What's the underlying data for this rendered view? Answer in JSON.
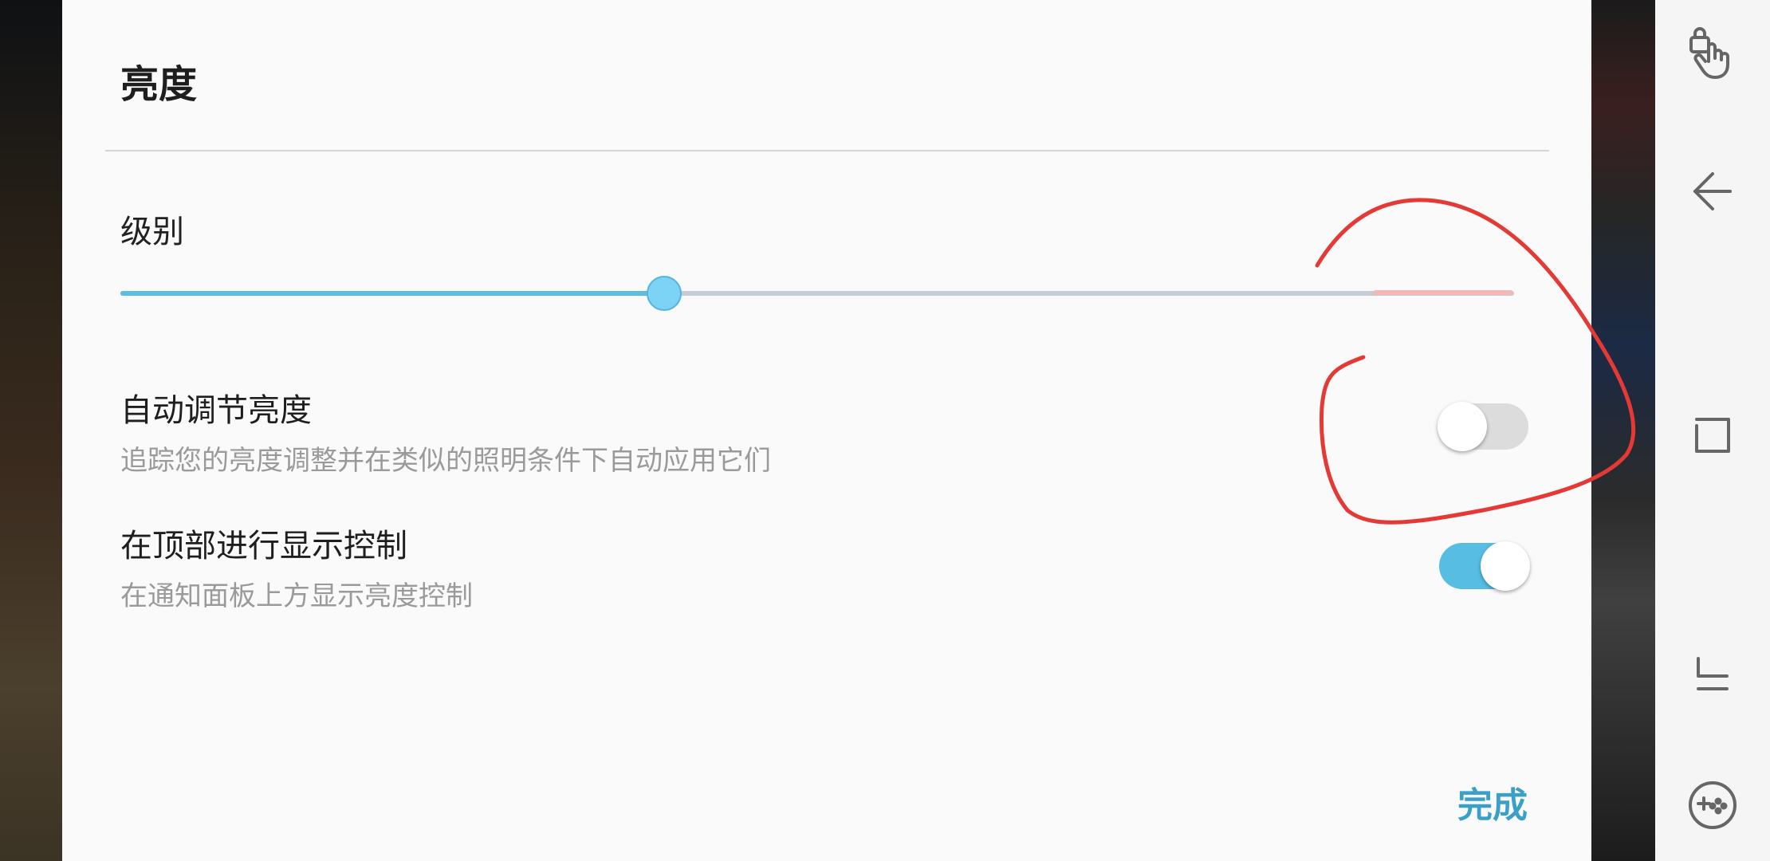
{
  "dialog": {
    "title": "亮度",
    "level": {
      "label": "级别",
      "value": 0.39
    },
    "settings": [
      {
        "title": "自动调节亮度",
        "description": "追踪您的亮度调整并在类似的照明条件下自动应用它们",
        "enabled": false
      },
      {
        "title": "在顶部进行显示控制",
        "description": "在通知面板上方显示亮度控制",
        "enabled": true
      }
    ],
    "done_label": "完成"
  },
  "sidebar": {
    "icons": [
      "touch-lock-icon",
      "back-icon",
      "recent-apps-icon",
      "home-icon",
      "game-tools-icon"
    ]
  },
  "colors": {
    "accent": "#57bde3",
    "annotation": "#e53935"
  }
}
